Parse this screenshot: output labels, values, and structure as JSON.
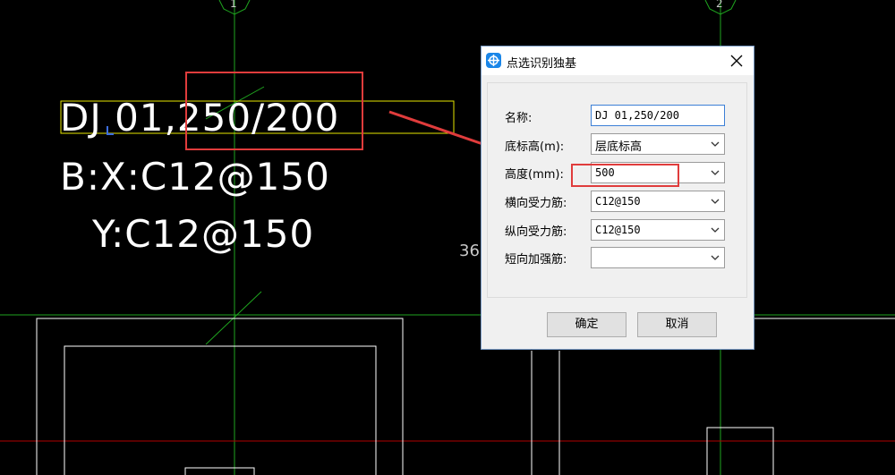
{
  "cad": {
    "grid_numbers": [
      "1",
      "2"
    ],
    "label_main": "DJ 01,250/200",
    "label_b": "B:X:C12@150",
    "label_y": "Y:C12@150",
    "dim_partial": "36"
  },
  "dialog": {
    "title": "点选识别独基",
    "fields": [
      {
        "label": "名称:",
        "value": "DJ 01,250/200",
        "type": "text"
      },
      {
        "label": "底标高(m):",
        "value": "层底标高",
        "type": "select"
      },
      {
        "label": "高度(mm):",
        "value": "500",
        "type": "select"
      },
      {
        "label": "横向受力筋:",
        "value": "C12@150",
        "type": "select"
      },
      {
        "label": "纵向受力筋:",
        "value": "C12@150",
        "type": "select"
      },
      {
        "label": "短向加强筋:",
        "value": "",
        "type": "select"
      }
    ],
    "ok_label": "确定",
    "cancel_label": "取消"
  },
  "colors": {
    "annotation": "#e03c3c",
    "grid_line": "#1fa51f",
    "axis_line": "#b00000",
    "label_box": "#e6e600",
    "dialog_accent": "#1a86e8"
  }
}
